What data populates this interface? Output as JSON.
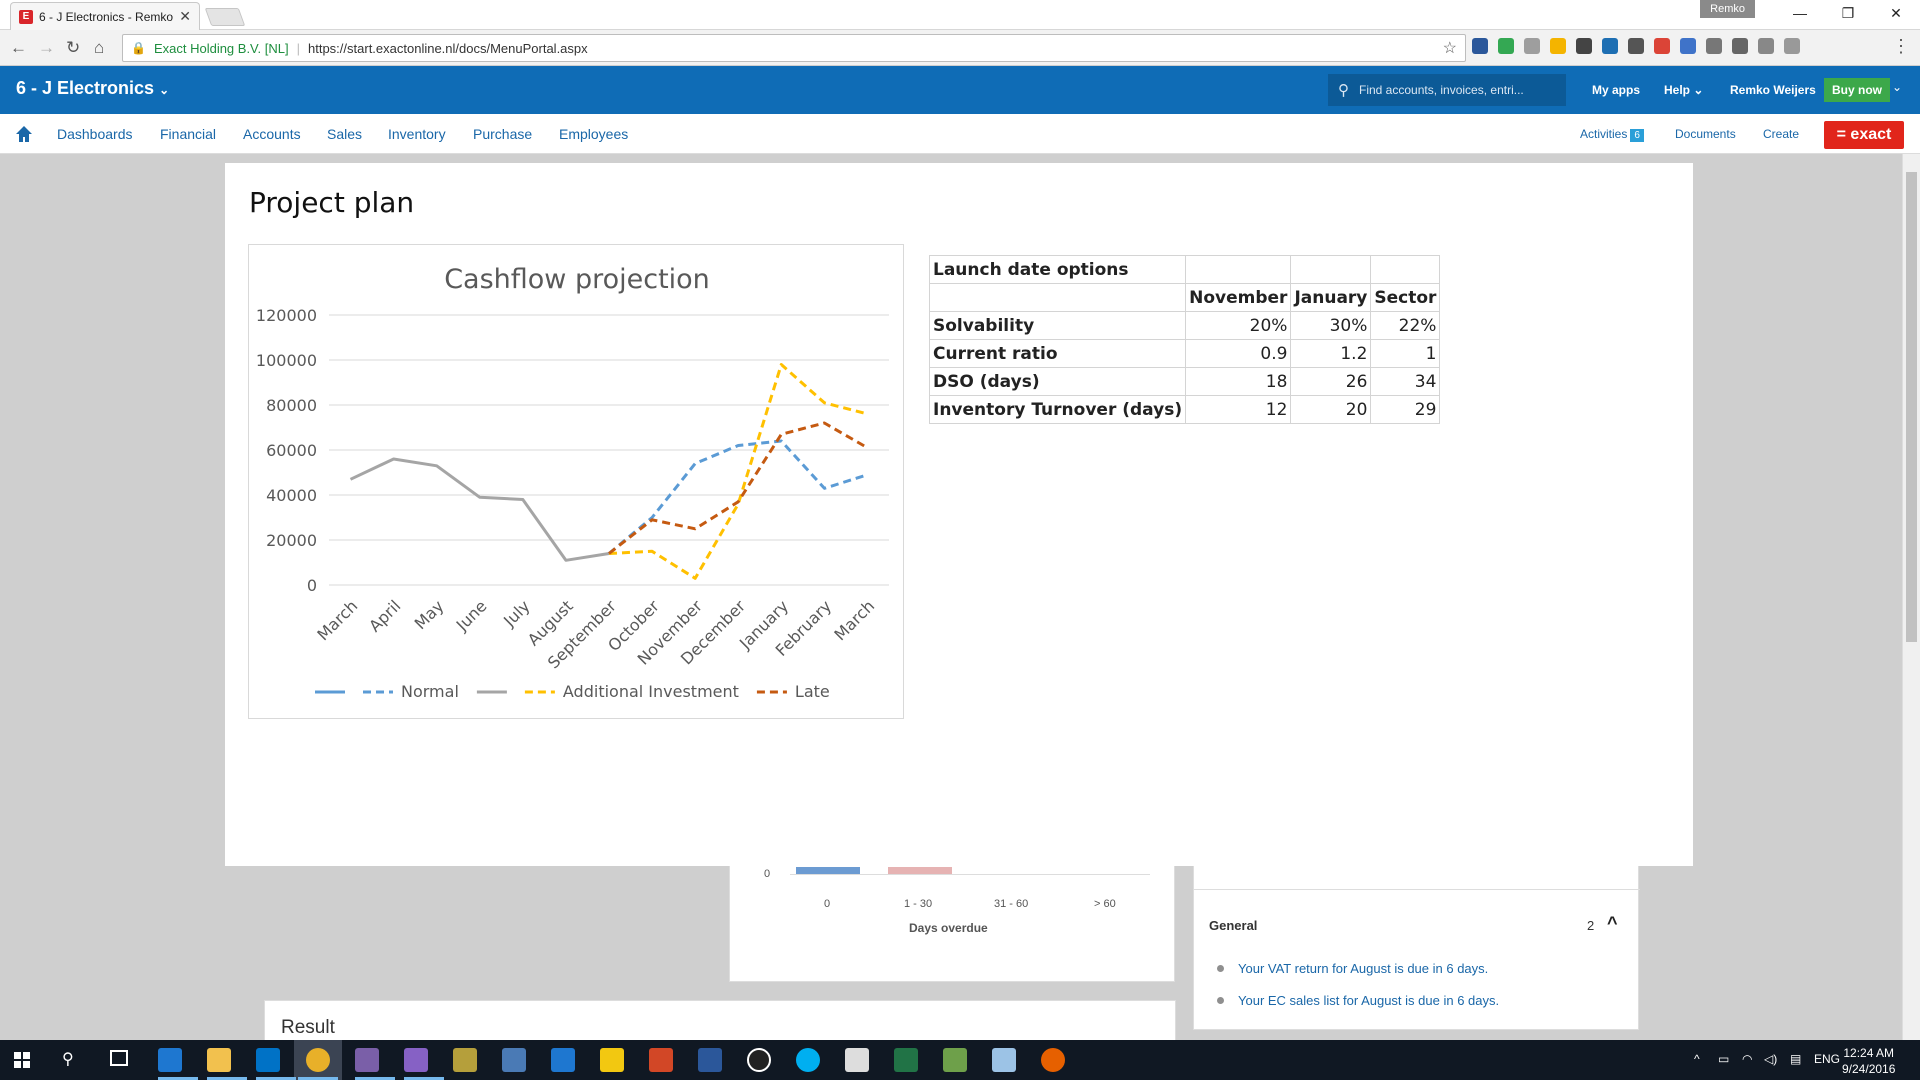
{
  "browser": {
    "tab_title": "6 - J Electronics - Remko",
    "tab_favicon": "E",
    "profile": "Remko",
    "secure_label": "Exact Holding B.V. [NL]",
    "url": "https://start.exactonline.nl/docs/MenuPortal.aspx"
  },
  "app": {
    "company": "6 - J Electronics",
    "search_placeholder": "Find accounts, invoices, entri...",
    "my_apps": "My apps",
    "help": "Help",
    "user": "Remko Weijers",
    "buy_now": "Buy now",
    "brand_color": "#0f6cb6",
    "logo": "= exact"
  },
  "menu": {
    "items": [
      "Dashboards",
      "Financial",
      "Accounts",
      "Sales",
      "Inventory",
      "Purchase",
      "Employees"
    ],
    "activities": "Activities",
    "activities_count": "6",
    "documents": "Documents",
    "create": "Create"
  },
  "background": {
    "aging_axis_zero": "0",
    "aging_categories": [
      "0",
      "1 - 30",
      "31 - 60",
      "> 60"
    ],
    "aging_xlabel": "Days overdue",
    "general_title": "General",
    "general_count": "2",
    "general_items": [
      "Your VAT return for August is due in 6 days.",
      "Your EC sales list for August is due in 6 days."
    ],
    "result_title": "Result"
  },
  "overlay": {
    "title": "Project plan"
  },
  "chart_data": {
    "type": "line",
    "title": "Cashflow projection",
    "categories": [
      "March",
      "April",
      "May",
      "June",
      "July",
      "August",
      "September",
      "October",
      "November",
      "December",
      "January",
      "February",
      "March"
    ],
    "ylim": [
      0,
      120000
    ],
    "yticks": [
      0,
      20000,
      40000,
      60000,
      80000,
      100000,
      120000
    ],
    "grid": true,
    "legend_position": "bottom",
    "series": [
      {
        "name": "",
        "color": "#5b9bd5",
        "dash": false,
        "values": [
          null,
          null,
          null,
          null,
          null,
          null,
          null,
          null,
          null,
          null,
          null,
          null,
          null
        ]
      },
      {
        "name": "Normal",
        "color": "#5b9bd5",
        "dash": true,
        "values": [
          null,
          null,
          null,
          null,
          null,
          null,
          14000,
          30000,
          54000,
          62000,
          64000,
          43000,
          49000
        ]
      },
      {
        "name": "",
        "color": "#a5a5a5",
        "dash": false,
        "values": [
          47000,
          56000,
          53000,
          39000,
          38000,
          11000,
          14000,
          null,
          null,
          null,
          null,
          null,
          null
        ]
      },
      {
        "name": "Additional Investment",
        "color": "#ffc000",
        "dash": true,
        "values": [
          null,
          null,
          null,
          null,
          null,
          null,
          14000,
          15000,
          3000,
          36000,
          98000,
          81000,
          76000
        ]
      },
      {
        "name": "Late",
        "color": "#c55a11",
        "dash": true,
        "values": [
          null,
          null,
          null,
          null,
          null,
          null,
          14000,
          29000,
          25000,
          37000,
          67000,
          72000,
          61000
        ]
      }
    ]
  },
  "launch_table": {
    "title": "Launch date options",
    "columns": [
      "November",
      "January",
      "Sector"
    ],
    "rows": [
      {
        "label": "Solvability",
        "values": [
          "20%",
          "30%",
          "22%"
        ]
      },
      {
        "label": "Current ratio",
        "values": [
          "0.9",
          "1.2",
          "1"
        ]
      },
      {
        "label": "DSO (days)",
        "values": [
          "18",
          "26",
          "34"
        ]
      },
      {
        "label": "Inventory Turnover (days)",
        "values": [
          "12",
          "20",
          "29"
        ]
      }
    ]
  },
  "taskbar": {
    "lang": "ENG",
    "time": "12:24 AM",
    "date": "9/24/2016"
  }
}
